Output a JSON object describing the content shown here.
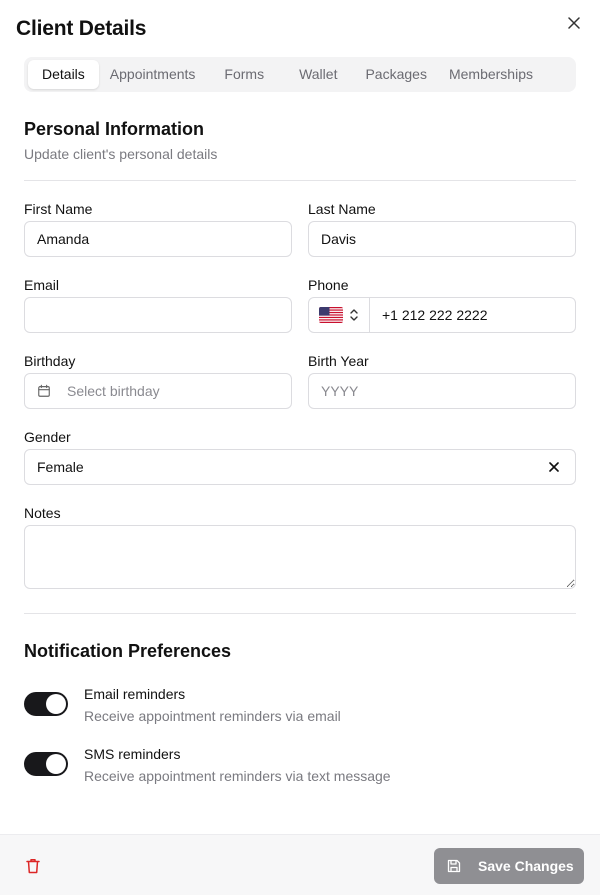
{
  "dialog": {
    "title": "Client Details"
  },
  "tabs": [
    {
      "label": "Details",
      "active": true
    },
    {
      "label": "Appointments",
      "active": false
    },
    {
      "label": "Forms",
      "active": false
    },
    {
      "label": "Wallet",
      "active": false
    },
    {
      "label": "Packages",
      "active": false
    },
    {
      "label": "Memberships",
      "active": false
    }
  ],
  "personal": {
    "title": "Personal Information",
    "subtitle": "Update client's personal details",
    "first_name": {
      "label": "First Name",
      "value": "Amanda"
    },
    "last_name": {
      "label": "Last Name",
      "value": "Davis"
    },
    "email": {
      "label": "Email",
      "value": ""
    },
    "phone": {
      "label": "Phone",
      "value": "+1 212 222 2222",
      "country": "US"
    },
    "birthday": {
      "label": "Birthday",
      "placeholder": "Select birthday"
    },
    "birth_year": {
      "label": "Birth Year",
      "placeholder": "YYYY"
    },
    "gender": {
      "label": "Gender",
      "value": "Female"
    },
    "notes": {
      "label": "Notes",
      "value": ""
    }
  },
  "notifications": {
    "title": "Notification Preferences",
    "items": [
      {
        "title": "Email reminders",
        "subtitle": "Receive appointment reminders via email",
        "enabled": true
      },
      {
        "title": "SMS reminders",
        "subtitle": "Receive appointment reminders via text message",
        "enabled": true
      }
    ]
  },
  "footer": {
    "save_label": "Save Changes"
  },
  "colors": {
    "accent": "#18181b",
    "save_disabled": "#8f8f93",
    "danger": "#dc2626"
  }
}
